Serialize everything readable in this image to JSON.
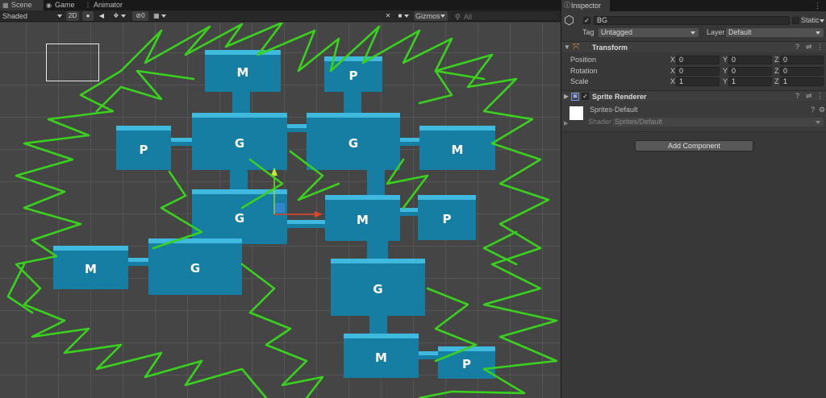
{
  "scene_tabs": [
    {
      "label": "Scene",
      "icon": "grid-icon"
    },
    {
      "label": "Game",
      "icon": "gamepad-icon"
    },
    {
      "label": "Animator",
      "icon": "animator-icon"
    }
  ],
  "toolbar": {
    "shading_mode": "Shaded",
    "mode_2d": "2D",
    "hidden_count": "0",
    "gizmos": "Gizmos",
    "search_placeholder": "All"
  },
  "rooms": [
    {
      "label": "M"
    },
    {
      "label": "P"
    },
    {
      "label": "P"
    },
    {
      "label": "G"
    },
    {
      "label": "G"
    },
    {
      "label": "M"
    },
    {
      "label": "G"
    },
    {
      "label": "M"
    },
    {
      "label": "P"
    },
    {
      "label": "M"
    },
    {
      "label": "G"
    },
    {
      "label": "G"
    },
    {
      "label": "M"
    },
    {
      "label": "P"
    }
  ],
  "inspector": {
    "tab_label": "Inspector",
    "object_name": "BG",
    "static_label": "Static",
    "tag_label": "Tag",
    "tag_value": "Untagged",
    "layer_label": "Layer",
    "layer_value": "Default",
    "transform": {
      "title": "Transform",
      "rows": [
        {
          "label": "Position",
          "x": "0",
          "y": "0",
          "z": "0"
        },
        {
          "label": "Rotation",
          "x": "0",
          "y": "0",
          "z": "0"
        },
        {
          "label": "Scale",
          "x": "1",
          "y": "1",
          "z": "1"
        }
      ],
      "axis": {
        "x": "X",
        "y": "Y",
        "z": "Z"
      }
    },
    "sprite_renderer": {
      "title": "Sprite Renderer",
      "material": "Sprites-Default",
      "shader_label": "Shader",
      "shader_value": "Sprites/Default"
    },
    "add_component": "Add Component"
  },
  "colors": {
    "room_fill": "#157ea2",
    "room_cap": "#3fb9dd",
    "scribble": "#3ad11e",
    "axis_x": "#e0452c",
    "axis_y": "#8bd33a"
  }
}
